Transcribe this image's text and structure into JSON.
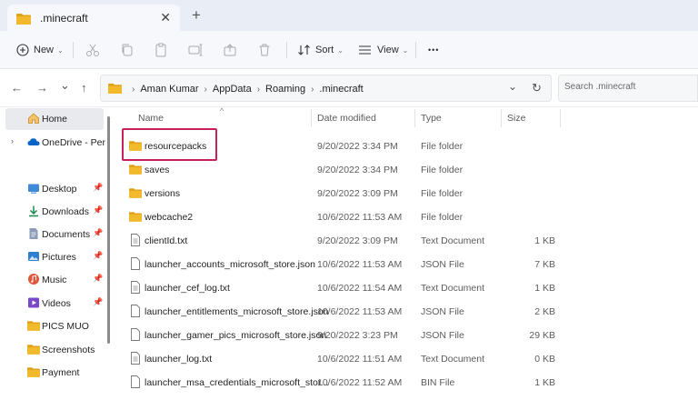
{
  "tab": {
    "title": ".minecraft",
    "close_glyph": "✕",
    "new_tab_glyph": "+"
  },
  "toolbar": {
    "new_label": "New",
    "sort_label": "Sort",
    "view_label": "View",
    "more_glyph": "•••",
    "icons": [
      "cut-icon",
      "copy-icon",
      "paste-icon",
      "rename-icon",
      "share-icon",
      "delete-icon"
    ]
  },
  "nav": {
    "back": "←",
    "forward": "→",
    "recent": "⌄",
    "up": "↑"
  },
  "address": {
    "crumbs": [
      "Aman Kumar",
      "AppData",
      "Roaming",
      ".minecraft"
    ],
    "dropdown_glyph": "⌄",
    "refresh_glyph": "↻"
  },
  "search": {
    "placeholder": "Search .minecraft"
  },
  "sidebar": {
    "items": [
      {
        "label": "Home",
        "icon": "home-icon"
      },
      {
        "label": "OneDrive - Perso",
        "icon": "cloud-icon"
      },
      {
        "label": "Desktop",
        "icon": "desktop-icon",
        "pinned": true
      },
      {
        "label": "Downloads",
        "icon": "download-icon",
        "pinned": true
      },
      {
        "label": "Documents",
        "icon": "document-icon",
        "pinned": true
      },
      {
        "label": "Pictures",
        "icon": "picture-icon",
        "pinned": true
      },
      {
        "label": "Music",
        "icon": "music-icon",
        "pinned": true
      },
      {
        "label": "Videos",
        "icon": "video-icon",
        "pinned": true
      },
      {
        "label": "PICS MUO",
        "icon": "folder-icon"
      },
      {
        "label": "Screenshots",
        "icon": "folder-icon"
      },
      {
        "label": "Payment",
        "icon": "folder-icon"
      }
    ]
  },
  "columns": {
    "name": "Name",
    "date": "Date modified",
    "type": "Type",
    "size": "Size"
  },
  "files": [
    {
      "name": "resourcepacks",
      "date": "9/20/2022 3:34 PM",
      "type": "File folder",
      "size": "",
      "kind": "folder"
    },
    {
      "name": "saves",
      "date": "9/20/2022 3:34 PM",
      "type": "File folder",
      "size": "",
      "kind": "folder"
    },
    {
      "name": "versions",
      "date": "9/20/2022 3:09 PM",
      "type": "File folder",
      "size": "",
      "kind": "folder"
    },
    {
      "name": "webcache2",
      "date": "10/6/2022 11:53 AM",
      "type": "File folder",
      "size": "",
      "kind": "folder"
    },
    {
      "name": "clientId.txt",
      "date": "9/20/2022 3:09 PM",
      "type": "Text Document",
      "size": "1 KB",
      "kind": "text"
    },
    {
      "name": "launcher_accounts_microsoft_store.json",
      "date": "10/6/2022 11:53 AM",
      "type": "JSON File",
      "size": "7 KB",
      "kind": "file"
    },
    {
      "name": "launcher_cef_log.txt",
      "date": "10/6/2022 11:54 AM",
      "type": "Text Document",
      "size": "1 KB",
      "kind": "text"
    },
    {
      "name": "launcher_entitlements_microsoft_store.json",
      "date": "10/6/2022 11:53 AM",
      "type": "JSON File",
      "size": "2 KB",
      "kind": "file"
    },
    {
      "name": "launcher_gamer_pics_microsoft_store.json",
      "date": "9/20/2022 3:23 PM",
      "type": "JSON File",
      "size": "29 KB",
      "kind": "file"
    },
    {
      "name": "launcher_log.txt",
      "date": "10/6/2022 11:51 AM",
      "type": "Text Document",
      "size": "0 KB",
      "kind": "text"
    },
    {
      "name": "launcher_msa_credentials_microsoft_stor...",
      "date": "10/6/2022 11:52 AM",
      "type": "BIN File",
      "size": "1 KB",
      "kind": "file"
    }
  ],
  "highlighted_item": "resourcepacks",
  "colors": {
    "folder": "#f2b92c",
    "folder_dark": "#e0a218",
    "highlight": "#c8205b",
    "accent": "#0067c0"
  }
}
